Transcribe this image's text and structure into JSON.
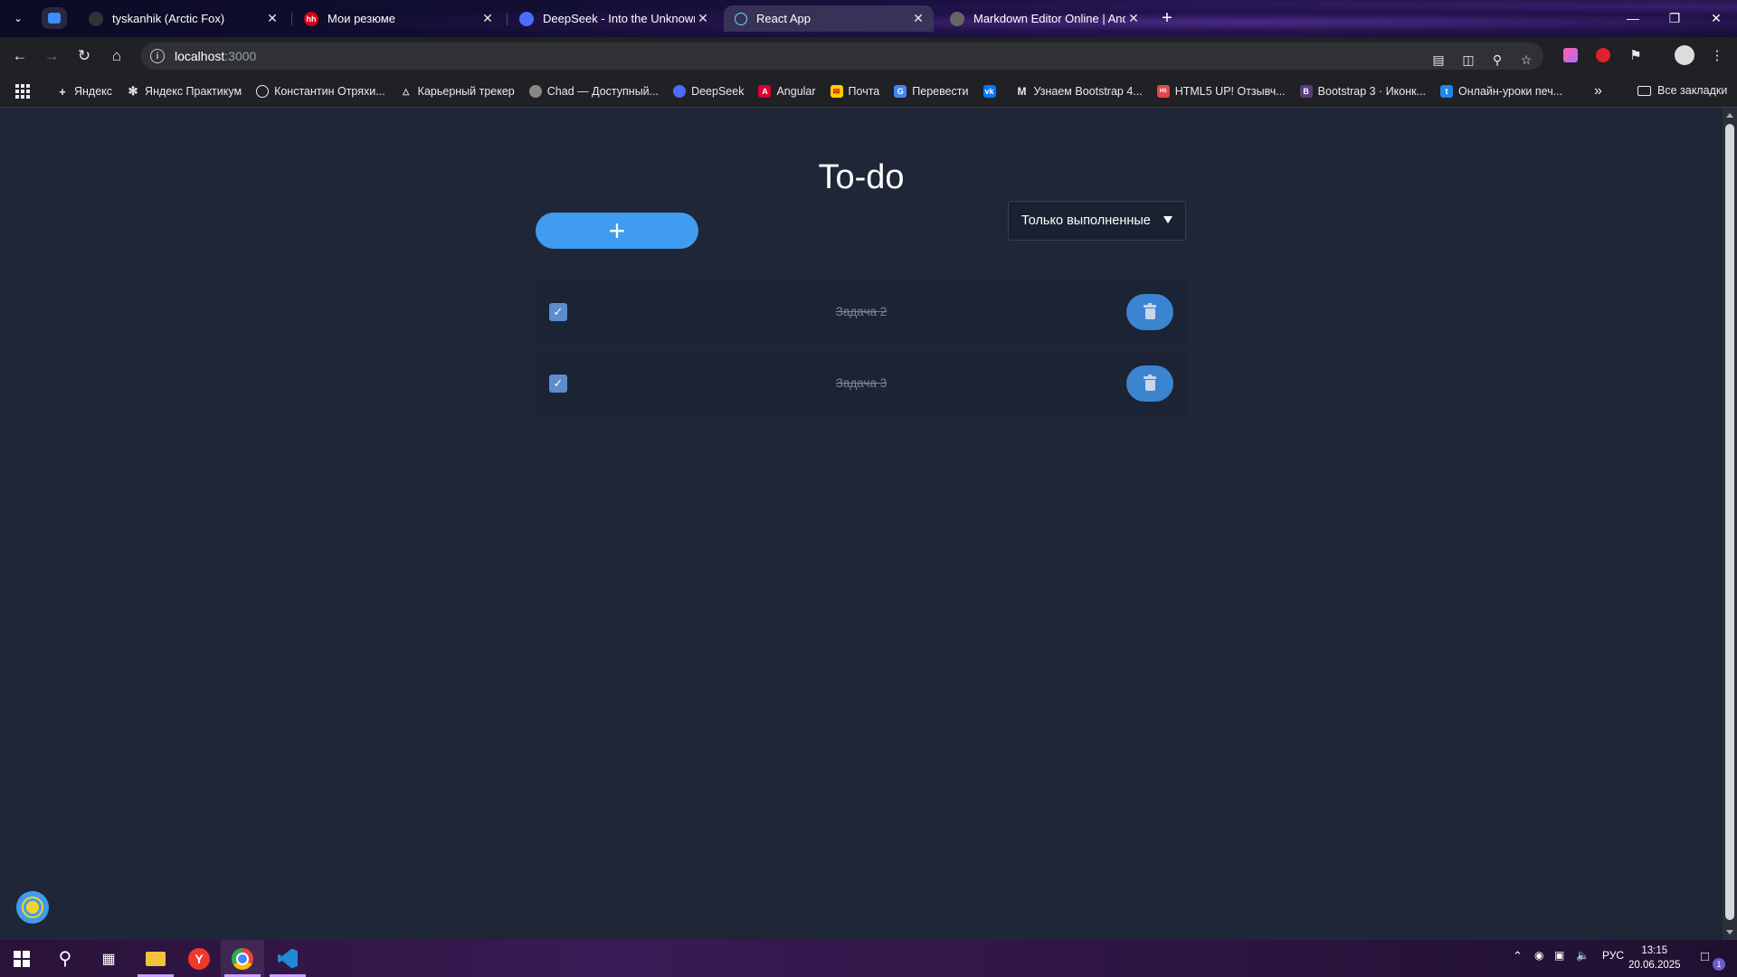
{
  "browser": {
    "tabs": [
      {
        "title": "tyskanhik (Arctic Fox)",
        "favicon": "github-icon",
        "active": false
      },
      {
        "title": "Мои резюме",
        "favicon": "hh-icon",
        "active": false
      },
      {
        "title": "DeepSeek - Into the Unknown",
        "favicon": "deepseek-icon",
        "active": false
      },
      {
        "title": "React App",
        "favicon": "react-icon",
        "active": true
      },
      {
        "title": "Markdown Editor Online | Ando",
        "favicon": "globe-icon",
        "active": false
      }
    ],
    "address": {
      "host": "localhost",
      "port": ":3000"
    },
    "bookmarks": [
      {
        "label": "Яндекс",
        "icon": "plus-icon"
      },
      {
        "label": "Яндекс Практикум",
        "icon": "asterisk-icon"
      },
      {
        "label": "Константин Отряхи...",
        "icon": "github-icon"
      },
      {
        "label": "Карьерный трекер",
        "icon": "triangle-icon"
      },
      {
        "label": "Chad — Доступный...",
        "icon": "chad-icon"
      },
      {
        "label": "DeepSeek",
        "icon": "deepseek-icon"
      },
      {
        "label": "Angular",
        "icon": "angular-icon"
      },
      {
        "label": "Почта",
        "icon": "mail-icon"
      },
      {
        "label": "Перевести",
        "icon": "translate-icon"
      },
      {
        "label": "",
        "icon": "vk-icon"
      },
      {
        "label": "Узнаем Bootstrap 4...",
        "icon": "medium-icon"
      },
      {
        "label": "HTML5 UP! Отзывч...",
        "icon": "html5up-icon"
      },
      {
        "label": "Bootstrap 3 · Иконк...",
        "icon": "bootstrap-icon"
      },
      {
        "label": "Онлайн-уроки печ...",
        "icon": "typing-icon"
      }
    ],
    "all_bookmarks": "Все закладки"
  },
  "app": {
    "title": "To-do",
    "add_label": "+",
    "filter": {
      "selected": "Только выполненные"
    },
    "tasks": [
      {
        "text": "Задача 2",
        "done": true
      },
      {
        "text": "Задача 3",
        "done": true
      }
    ]
  },
  "taskbar": {
    "lang": "РУС",
    "time": "13:15",
    "date": "20.06.2025",
    "notifications": "1"
  },
  "colors": {
    "accent": "#3f9cf0",
    "background": "#1f2637",
    "task_bg": "#1b2335"
  }
}
